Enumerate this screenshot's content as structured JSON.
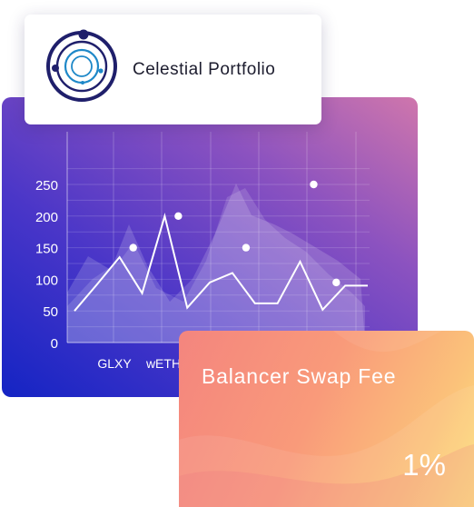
{
  "brand": {
    "name": "Celestial Portfolio",
    "logo_icon": "orbit-logo-icon"
  },
  "chart_data": {
    "type": "line",
    "categories": [
      "GLXY",
      "wETH"
    ],
    "yticks": [
      0,
      50,
      100,
      150,
      200,
      250
    ],
    "ylim": [
      0,
      300
    ],
    "grid": true,
    "area_background": true,
    "line": [
      50,
      92,
      135,
      78,
      200,
      55,
      95,
      110,
      62,
      62,
      128,
      52,
      90,
      90
    ],
    "points": [
      {
        "x": 2,
        "y": 150
      },
      {
        "x": 4,
        "y": 200
      },
      {
        "x": 7,
        "y": 150
      },
      {
        "x": 10,
        "y": 250
      },
      {
        "x": 11,
        "y": 95
      }
    ]
  },
  "fee_card": {
    "title": "Balancer Swap Fee",
    "value": "1%"
  },
  "colors": {
    "chart_gradient_start": "#1424c4",
    "chart_gradient_end": "#cf76ac",
    "fee_gradient_start": "#f4857e",
    "fee_gradient_end": "#fde07c",
    "logo_navy": "#1f1f6b",
    "logo_blue": "#1e88c8"
  }
}
